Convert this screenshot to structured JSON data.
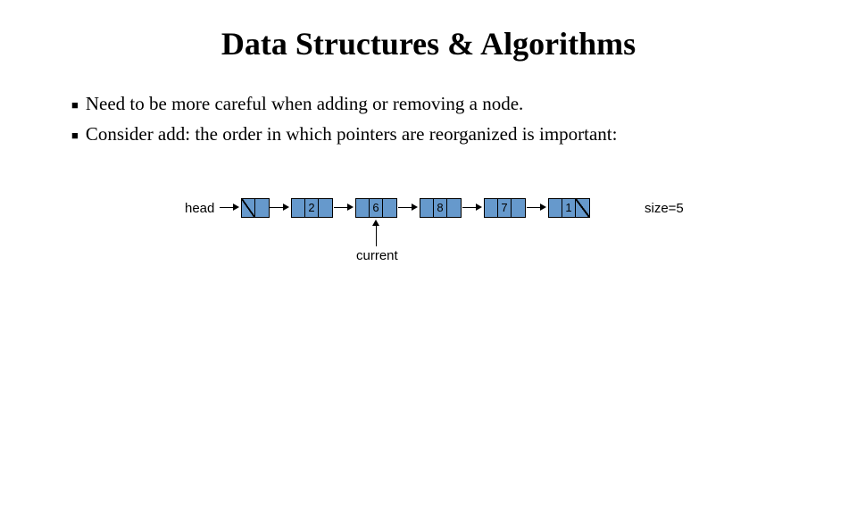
{
  "title": "Data Structures & Algorithms",
  "bullets": [
    "Need to be more careful when adding or removing a node.",
    "Consider add: the order in which pointers are reorganized is important:"
  ],
  "diagram": {
    "head_label": "head",
    "current_label": "current",
    "size_label": "size=5",
    "nodes": [
      {
        "value": "2"
      },
      {
        "value": "6"
      },
      {
        "value": "8"
      },
      {
        "value": "7"
      },
      {
        "value": "1"
      }
    ]
  }
}
